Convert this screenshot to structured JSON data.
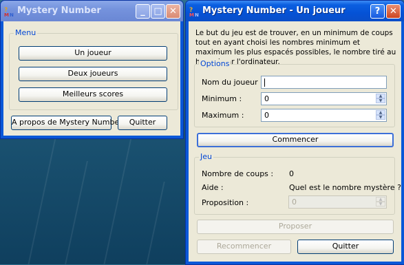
{
  "main_window": {
    "title": "Mystery Number",
    "menu": {
      "legend": "Menu",
      "buttons": [
        "Un joueur",
        "Deux joueurs",
        "Meilleurs scores"
      ]
    },
    "about_button": "A propos de Mystery Number",
    "quit_button": "Quitter"
  },
  "game_window": {
    "title": "Mystery Number - Un joueur",
    "description": "Le but du jeu est de trouver, en un minimum de coups tout en ayant choisi les nombres minimum et maximum les plus espacés possibles, le nombre tiré au hasard par l'ordinateur.",
    "options": {
      "legend": "Options",
      "player_name_label": "Nom du joueur :",
      "player_name_value": "",
      "minimum_label": "Minimum :",
      "minimum_value": "0",
      "maximum_label": "Maximum :",
      "maximum_value": "0"
    },
    "start_button": "Commencer",
    "game": {
      "legend": "Jeu",
      "moves_label": "Nombre de coups :",
      "moves_value": "0",
      "help_label": "Aide :",
      "help_value": "Quel est le nombre mystère ?",
      "proposal_label": "Proposition :",
      "proposal_value": "0"
    },
    "propose_button": "Proposer",
    "restart_button": "Recommencer",
    "quit_button": "Quitter"
  },
  "icons": {
    "app": "mystery-number-app-icon",
    "minimize": "minimize-icon",
    "maximize": "maximize-icon",
    "close": "close-icon",
    "help": "help-icon"
  }
}
